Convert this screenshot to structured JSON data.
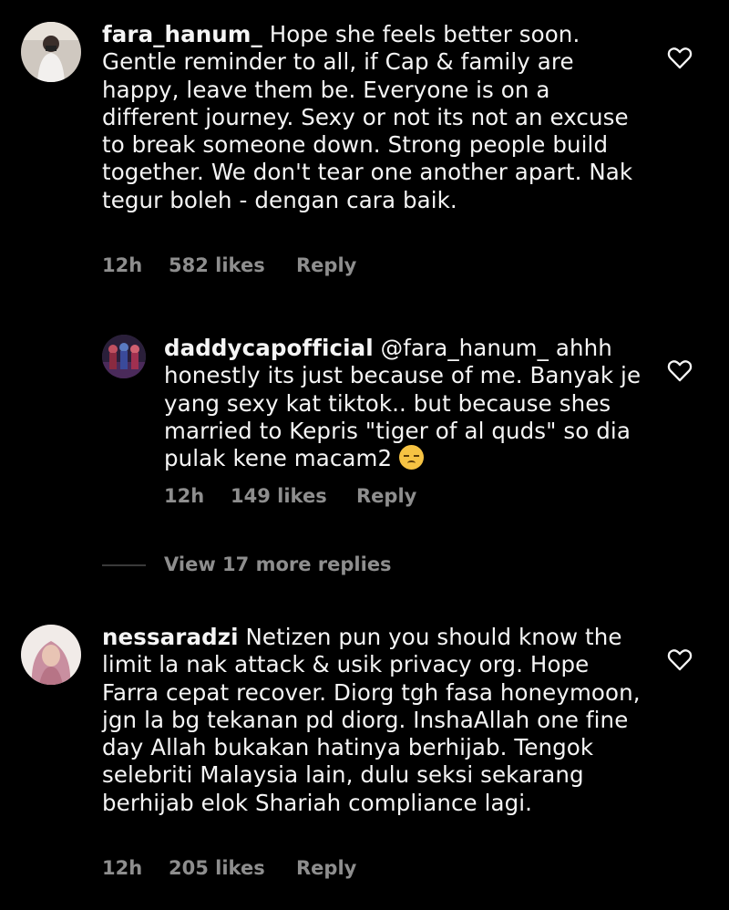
{
  "comments": [
    {
      "username": "fara_hanum_",
      "text": "Hope she feels better soon. Gentle reminder to all, if Cap & family are happy, leave them be. Everyone is on a different journey. Sexy or not its not an excuse to break someone down. Strong people build together. We don't tear one another apart. Nak tegur boleh - dengan cara baik.",
      "time": "12h",
      "likes": "582 likes",
      "reply_label": "Reply"
    },
    {
      "username": "daddycapofficial",
      "mention": "@fara_hanum_",
      "text": "ahhh honestly its just because of me. Banyak je yang sexy kat tiktok.. but because shes married to Kepris \"tiger of al quds\" so dia pulak kene macam2",
      "emoji": "pensive-face-emoji",
      "time": "12h",
      "likes": "149 likes",
      "reply_label": "Reply"
    },
    {
      "username": "nessaradzi",
      "text": "Netizen pun you should know the limit la nak attack & usik privacy org. Hope Farra cepat recover. Diorg tgh fasa honeymoon, jgn la bg tekanan pd diorg. InshaAllah one fine day Allah bukakan hatinya berhijab. Tengok selebriti Malaysia lain, dulu seksi sekarang berhijab elok Shariah compliance lagi.",
      "time": "12h",
      "likes": "205 likes",
      "reply_label": "Reply"
    }
  ],
  "view_more_replies": "View 17 more replies",
  "icons": {
    "like": "heart-outline-icon"
  },
  "colors": {
    "background": "#000000",
    "text": "#f5f5f5",
    "muted": "#8e8e8e"
  }
}
